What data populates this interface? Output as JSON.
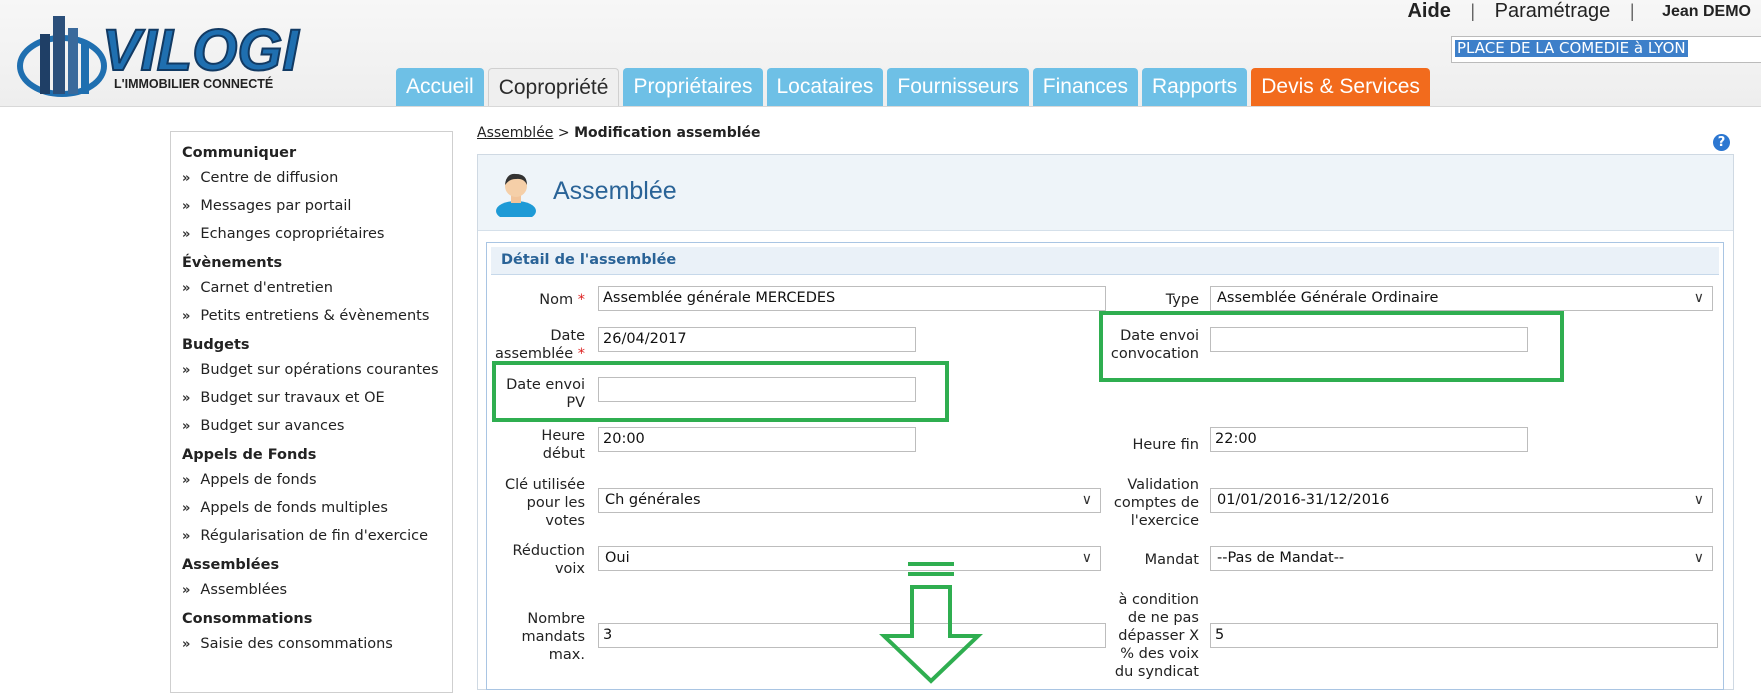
{
  "brand": {
    "name": "VILOGI",
    "tagline": "L'IMMOBILIER CONNECTÉ"
  },
  "toplinks": {
    "help": "Aide",
    "sep": "|",
    "settings": "Paramétrage",
    "user": "Jean DEMO"
  },
  "building": {
    "value": "PLACE DE LA COMEDIE à LYON"
  },
  "tabs": [
    {
      "label": "Accueil"
    },
    {
      "label": "Copropriété"
    },
    {
      "label": "Propriétaires"
    },
    {
      "label": "Locataires"
    },
    {
      "label": "Fournisseurs"
    },
    {
      "label": "Finances"
    },
    {
      "label": "Rapports"
    },
    {
      "label": "Devis & Services"
    }
  ],
  "sidebar": {
    "chevron": "»",
    "sections": [
      {
        "title": "Communiquer",
        "items": [
          "Centre de diffusion",
          "Messages par portail",
          "Echanges copropriétaires"
        ]
      },
      {
        "title": "Évènements",
        "items": [
          "Carnet d'entretien",
          "Petits entretiens & évènements"
        ]
      },
      {
        "title": "Budgets",
        "items": [
          "Budget sur opérations courantes",
          "Budget sur travaux et OE",
          "Budget sur avances"
        ]
      },
      {
        "title": "Appels de Fonds",
        "items": [
          "Appels de fonds",
          "Appels de fonds multiples",
          "Régularisation de fin d'exercice"
        ]
      },
      {
        "title": "Assemblées",
        "items": [
          "Assemblées"
        ]
      },
      {
        "title": "Consommations",
        "items": [
          "Saisie des consommations"
        ]
      }
    ]
  },
  "breadcrumb": {
    "link": "Assemblée",
    "sep": ">",
    "current": "Modification assemblée"
  },
  "help_icon": "?",
  "panel": {
    "title": "Assemblée",
    "section_title": "Détail de l'assemblée"
  },
  "form": {
    "required_mark": "*",
    "nom": {
      "label": "Nom",
      "value": "Assemblée générale MERCEDES"
    },
    "type": {
      "label": "Type",
      "value": "Assemblée Générale Ordinaire"
    },
    "date_assemblee": {
      "label1": "Date",
      "label2": "assemblée",
      "value": "26/04/2017"
    },
    "date_envoi_convocation": {
      "label1": "Date envoi",
      "label2": "convocation",
      "value": ""
    },
    "date_envoi_pv": {
      "label1": "Date envoi",
      "label2": "PV",
      "value": ""
    },
    "heure_debut": {
      "label1": "Heure",
      "label2": "début",
      "value": "20:00"
    },
    "heure_fin": {
      "label": "Heure fin",
      "value": "22:00"
    },
    "cle": {
      "label1": "Clé utilisée",
      "label2": "pour les",
      "label3": "votes",
      "value": "Ch générales"
    },
    "validation": {
      "label1": "Validation",
      "label2": "comptes de",
      "label3": "l'exercice",
      "value": "01/01/2016-31/12/2016"
    },
    "reduction": {
      "label1": "Réduction",
      "label2": "voix",
      "value": "Oui"
    },
    "mandat": {
      "label": "Mandat",
      "value": "--Pas de Mandat--"
    },
    "nombre_mandats": {
      "label1": "Nombre",
      "label2": "mandats",
      "label3": "max.",
      "value": "3"
    },
    "condition": {
      "label1": "à condition",
      "label2": "de ne pas",
      "label3": "dépasser X",
      "label4": "% des voix",
      "label5": "du syndicat",
      "value": "5"
    }
  },
  "colors": {
    "tab": "#6ec0e6",
    "tab_orange": "#f26b1d",
    "highlight": "#2fae50",
    "title": "#2a6397"
  }
}
